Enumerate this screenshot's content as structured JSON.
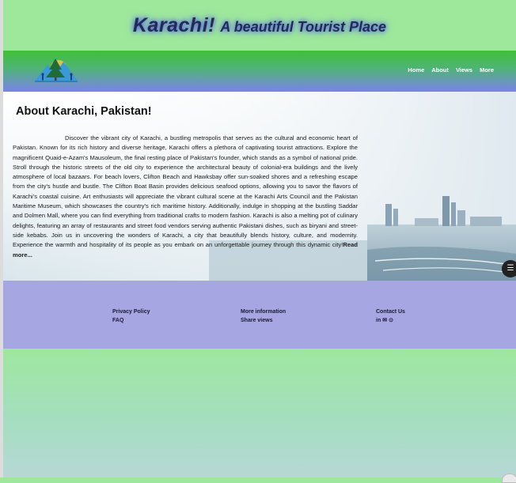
{
  "header": {
    "title_main": "Karachi!",
    "title_rest": "A beautiful Tourist Place"
  },
  "nav": {
    "items": [
      "Home",
      "About",
      "Views",
      "More"
    ]
  },
  "hero": {
    "heading": "About Karachi, Pakistan!",
    "body": "Discover the vibrant city of Karachi, a bustling metropolis that serves as the cultural and economic heart of Pakistan. Known for its rich history and diverse heritage, Karachi offers a plethora of captivating tourist attractions. Explore the magnificent Quaid-e-Azam's Mausoleum, the final resting place of Pakistan's founder, which stands as a symbol of national pride. Stroll through the historic streets of the old city to experience the architectural beauty of colonial-era buildings and the lively atmosphere of local bazaars. For beach lovers, Clifton Beach and Hawksbay offer sun-soaked shores and a refreshing escape from the city's hustle and bustle. The Clifton Boat Basin provides delicious seafood options, allowing you to savor the flavors of Karachi's coastal cuisine. Art enthusiasts will appreciate the vibrant cultural scene at the Karachi Arts Council and the Pakistan Maritime Museum, which showcases the country's rich maritime history. Additionally, indulge in shopping at the bustling Saddar and Dolmen Mall, where you can find everything from traditional crafts to modern fashion. Karachi is also a melting pot of culinary delights, featuring an array of restaurants and street food vendors serving authentic Pakistani dishes, such as biryani and street-side kebabs. Join us in uncovering the wonders of Karachi, a city that beautifully blends history, culture, and modernity. Experience the warmth and hospitality of its people as you embark on an unforgettable journey through this dynamic city!",
    "read_more": "Read more..."
  },
  "footer": {
    "col1": [
      "Privacy Policy",
      "FAQ"
    ],
    "col2": [
      "More information",
      "Share views"
    ],
    "col3_title": "Contact Us",
    "social": [
      "in",
      "✉",
      "⊙"
    ]
  },
  "colors": {
    "page_green": "#9de89c",
    "nav_top": "#41c036",
    "nav_bottom": "#7b83ea",
    "footer": "#a6a6e2",
    "title_glow": "#4a5bd8"
  },
  "icons": [
    "logo-mountain-tree-icon",
    "filter-settings-icon"
  ]
}
